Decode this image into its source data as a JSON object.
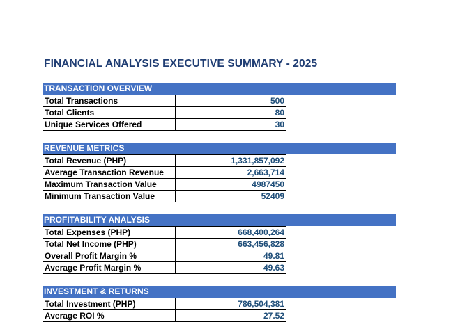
{
  "title": "FINANCIAL ANALYSIS EXECUTIVE SUMMARY - 2025",
  "colors": {
    "header_fill": "#4472c4",
    "header_text": "#ffffff",
    "title_text": "#1f3d73",
    "value_text": "#1f4e79"
  },
  "sections": [
    {
      "title": "TRANSACTION OVERVIEW",
      "rows": [
        {
          "label": "Total Transactions",
          "value": "500"
        },
        {
          "label": "Total Clients",
          "value": "80"
        },
        {
          "label": "Unique Services Offered",
          "value": "30"
        }
      ]
    },
    {
      "title": "REVENUE METRICS",
      "rows": [
        {
          "label": "Total Revenue (PHP)",
          "value": "1,331,857,092"
        },
        {
          "label": "Average Transaction Revenue",
          "value": "2,663,714"
        },
        {
          "label": "Maximum Transaction Value",
          "value": "4987450"
        },
        {
          "label": "Minimum Transaction Value",
          "value": "52409"
        }
      ]
    },
    {
      "title": "PROFITABILITY ANALYSIS",
      "rows": [
        {
          "label": "Total Expenses (PHP)",
          "value": "668,400,264"
        },
        {
          "label": "Total Net Income (PHP)",
          "value": "663,456,828"
        },
        {
          "label": "Overall Profit Margin %",
          "value": "49.81"
        },
        {
          "label": "Average Profit Margin %",
          "value": "49.63"
        }
      ]
    },
    {
      "title": "INVESTMENT & RETURNS",
      "rows": [
        {
          "label": "Total Investment (PHP)",
          "value": "786,504,381"
        },
        {
          "label": "Average ROI %",
          "value": "27.52"
        }
      ]
    }
  ]
}
